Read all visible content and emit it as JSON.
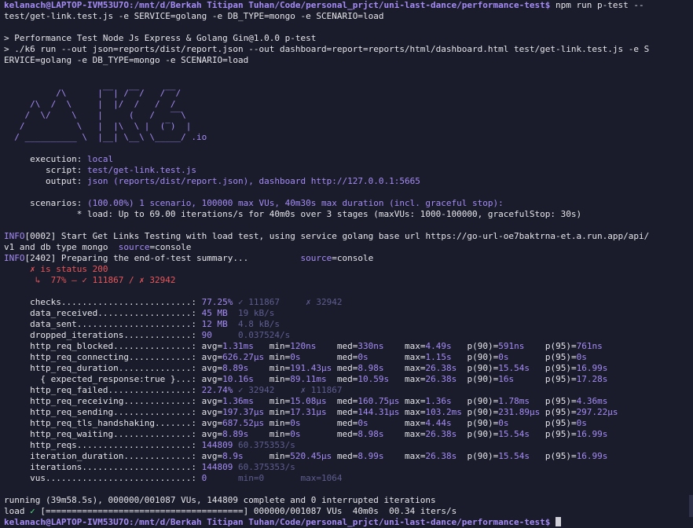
{
  "prompt": {
    "text": "kelanach@LAPTOP-IVM53U7O:/mnt/d/Berkah Titipan Tuhan/Code/personal_prjct/uni-last-dance/performance-test$",
    "command": " npm run p-test --",
    "command_cont": "test/get-link.test.js -e SERVICE=golang -e DB_TYPE=mongo -e SCENARIO=load"
  },
  "npm": {
    "line1": "> Performance Test Node Js Express & Golang Gin@1.0.0 p-test",
    "line2": "> ./k6 run --out json=reports/dist/report.json --out dashboard=report=reports/html/dashboard.html test/get-link.test.js -e S",
    "line3": "ERVICE=golang -e DB_TYPE=mongo -e SCENARIO=load"
  },
  "logo_lines": [
    "          /\\      |‾‾| /‾‾/   /‾‾/",
    "     /\\  /  \\     |  |/  /   /  /",
    "    /  \\/    \\    |     (   /   ‾‾\\",
    "   /          \\   |  |\\  \\ |  (‾)  |",
    "  / __________ \\  |__| \\__\\ \\_____/ .io"
  ],
  "execution": {
    "execution_label": "     execution: ",
    "execution_value": "local",
    "script_label": "        script: ",
    "script_value": "test/get-link.test.js",
    "output_label": "        output: ",
    "output_value": "json (reports/dist/report.json), dashboard http://127.0.0.1:5665"
  },
  "scenarios": {
    "label": "     scenarios: ",
    "value": "(100.00%) 1 scenario, 100000 max VUs, 40m30s max duration (incl. graceful stop):",
    "detail": "              * load: Up to 69.00 iterations/s for 40m0s over 3 stages (maxVUs: 1000-100000, gracefulStop: 30s)"
  },
  "logs": [
    {
      "level": "INFO",
      "code": "[0002]",
      "msg": " Start Get Links Testing with load test, using service golang base url https://go-url-oe7baktrna-et.a.run.app/api/"
    },
    {
      "level": "",
      "code": "",
      "msg": "v1 and db type mongo  "
    },
    {
      "level": "INFO",
      "code": "[2402]",
      "msg": " Preparing the end-of-test summary...          "
    }
  ],
  "source": {
    "key": "source",
    "eq": "=",
    "value": "console"
  },
  "checks_tree": {
    "line1": "     ✗ is status 200",
    "line2": "      ↳  77% — ✓ 111867 / ✗ 32942"
  },
  "metrics": [
    {
      "name": "     checks.........................: ",
      "cols": [
        [
          "77.25%",
          "p"
        ],
        [
          " ✓ 111867     ✗ 32942",
          "d"
        ]
      ]
    },
    {
      "name": "     data_received..................: ",
      "cols": [
        [
          "45 MB",
          "p"
        ],
        [
          "  19 kB/s",
          "d"
        ]
      ]
    },
    {
      "name": "     data_sent......................: ",
      "cols": [
        [
          "12 MB",
          "p"
        ],
        [
          "  4.8 kB/s",
          "d"
        ]
      ]
    },
    {
      "name": "     dropped_iterations.............: ",
      "cols": [
        [
          "90",
          "p"
        ],
        [
          "     0.037524/s",
          "d"
        ]
      ]
    },
    {
      "name": "     http_req_blocked...............: ",
      "cols": [
        [
          "avg=",
          "w"
        ],
        [
          "1.31ms",
          "p"
        ],
        [
          "   min=",
          "w"
        ],
        [
          "120ns",
          "p"
        ],
        [
          "    med=",
          "w"
        ],
        [
          "330ns",
          "p"
        ],
        [
          "    max=",
          "w"
        ],
        [
          "4.49s",
          "p"
        ],
        [
          "   p(90)=",
          "w"
        ],
        [
          "591ns",
          "p"
        ],
        [
          "    p(95)=",
          "w"
        ],
        [
          "761ns",
          "p"
        ]
      ]
    },
    {
      "name": "     http_req_connecting............: ",
      "cols": [
        [
          "avg=",
          "w"
        ],
        [
          "626.27µs",
          "p"
        ],
        [
          " min=",
          "w"
        ],
        [
          "0s",
          "p"
        ],
        [
          "       med=",
          "w"
        ],
        [
          "0s",
          "p"
        ],
        [
          "       max=",
          "w"
        ],
        [
          "1.15s",
          "p"
        ],
        [
          "   p(90)=",
          "w"
        ],
        [
          "0s",
          "p"
        ],
        [
          "       p(95)=",
          "w"
        ],
        [
          "0s",
          "p"
        ]
      ]
    },
    {
      "name": "     http_req_duration..............: ",
      "cols": [
        [
          "avg=",
          "w"
        ],
        [
          "8.89s",
          "p"
        ],
        [
          "    min=",
          "w"
        ],
        [
          "191.43µs",
          "p"
        ],
        [
          " med=",
          "w"
        ],
        [
          "8.98s",
          "p"
        ],
        [
          "    max=",
          "w"
        ],
        [
          "26.38s",
          "p"
        ],
        [
          "  p(90)=",
          "w"
        ],
        [
          "15.54s",
          "p"
        ],
        [
          "   p(95)=",
          "w"
        ],
        [
          "16.99s",
          "p"
        ]
      ]
    },
    {
      "name": "       { expected_response:true }...: ",
      "cols": [
        [
          "avg=",
          "w"
        ],
        [
          "10.16s",
          "p"
        ],
        [
          "   min=",
          "w"
        ],
        [
          "89.11ms",
          "p"
        ],
        [
          "  med=",
          "w"
        ],
        [
          "10.59s",
          "p"
        ],
        [
          "   max=",
          "w"
        ],
        [
          "26.38s",
          "p"
        ],
        [
          "  p(90)=",
          "w"
        ],
        [
          "16s",
          "p"
        ],
        [
          "      p(95)=",
          "w"
        ],
        [
          "17.28s",
          "p"
        ]
      ]
    },
    {
      "name": "     http_req_failed................: ",
      "cols": [
        [
          "22.74%",
          "p"
        ],
        [
          " ✓ 32942     ✗ 111867",
          "d"
        ]
      ]
    },
    {
      "name": "     http_req_receiving.............: ",
      "cols": [
        [
          "avg=",
          "w"
        ],
        [
          "1.36ms",
          "p"
        ],
        [
          "   min=",
          "w"
        ],
        [
          "15.08µs",
          "p"
        ],
        [
          "  med=",
          "w"
        ],
        [
          "160.75µs",
          "p"
        ],
        [
          " max=",
          "w"
        ],
        [
          "1.36s",
          "p"
        ],
        [
          "   p(90)=",
          "w"
        ],
        [
          "1.78ms",
          "p"
        ],
        [
          "   p(95)=",
          "w"
        ],
        [
          "4.36ms",
          "p"
        ]
      ]
    },
    {
      "name": "     http_req_sending...............: ",
      "cols": [
        [
          "avg=",
          "w"
        ],
        [
          "197.37µs",
          "p"
        ],
        [
          " min=",
          "w"
        ],
        [
          "17.31µs",
          "p"
        ],
        [
          "  med=",
          "w"
        ],
        [
          "144.31µs",
          "p"
        ],
        [
          " max=",
          "w"
        ],
        [
          "103.2ms",
          "p"
        ],
        [
          " p(90)=",
          "w"
        ],
        [
          "231.89µs",
          "p"
        ],
        [
          " p(95)=",
          "w"
        ],
        [
          "297.22µs",
          "p"
        ]
      ]
    },
    {
      "name": "     http_req_tls_handshaking.......: ",
      "cols": [
        [
          "avg=",
          "w"
        ],
        [
          "687.52µs",
          "p"
        ],
        [
          " min=",
          "w"
        ],
        [
          "0s",
          "p"
        ],
        [
          "       med=",
          "w"
        ],
        [
          "0s",
          "p"
        ],
        [
          "       max=",
          "w"
        ],
        [
          "4.44s",
          "p"
        ],
        [
          "   p(90)=",
          "w"
        ],
        [
          "0s",
          "p"
        ],
        [
          "       p(95)=",
          "w"
        ],
        [
          "0s",
          "p"
        ]
      ]
    },
    {
      "name": "     http_req_waiting...............: ",
      "cols": [
        [
          "avg=",
          "w"
        ],
        [
          "8.89s",
          "p"
        ],
        [
          "    min=",
          "w"
        ],
        [
          "0s",
          "p"
        ],
        [
          "       med=",
          "w"
        ],
        [
          "8.98s",
          "p"
        ],
        [
          "    max=",
          "w"
        ],
        [
          "26.38s",
          "p"
        ],
        [
          "  p(90)=",
          "w"
        ],
        [
          "15.54s",
          "p"
        ],
        [
          "   p(95)=",
          "w"
        ],
        [
          "16.99s",
          "p"
        ]
      ]
    },
    {
      "name": "     http_reqs......................: ",
      "cols": [
        [
          "144809",
          "p"
        ],
        [
          " 60.375353/s",
          "d"
        ]
      ]
    },
    {
      "name": "     iteration_duration.............: ",
      "cols": [
        [
          "avg=",
          "w"
        ],
        [
          "8.9s",
          "p"
        ],
        [
          "     min=",
          "w"
        ],
        [
          "520.45µs",
          "p"
        ],
        [
          " med=",
          "w"
        ],
        [
          "8.99s",
          "p"
        ],
        [
          "    max=",
          "w"
        ],
        [
          "26.38s",
          "p"
        ],
        [
          "  p(90)=",
          "w"
        ],
        [
          "15.54s",
          "p"
        ],
        [
          "   p(95)=",
          "w"
        ],
        [
          "16.99s",
          "p"
        ]
      ]
    },
    {
      "name": "     iterations.....................: ",
      "cols": [
        [
          "144809",
          "p"
        ],
        [
          " 60.375353/s",
          "d"
        ]
      ]
    },
    {
      "name": "     vus............................: ",
      "cols": [
        [
          "0",
          "p"
        ],
        [
          "      min=0       max=1064",
          "d"
        ]
      ]
    }
  ],
  "running": "running (39m58.5s), 000000/001087 VUs, 144809 complete and 0 interrupted iterations",
  "progress": {
    "label": "load ",
    "check": "✓",
    "bar": " [======================================] ",
    "stats": "000000/001087 VUs  40m0s  00.34 iters/s",
    "fraction": 1.0
  },
  "final_prompt": "kelanach@LAPTOP-IVM53U7O:/mnt/d/Berkah Titipan Tuhan/Code/personal_prjct/uni-last-dance/performance-test$ "
}
